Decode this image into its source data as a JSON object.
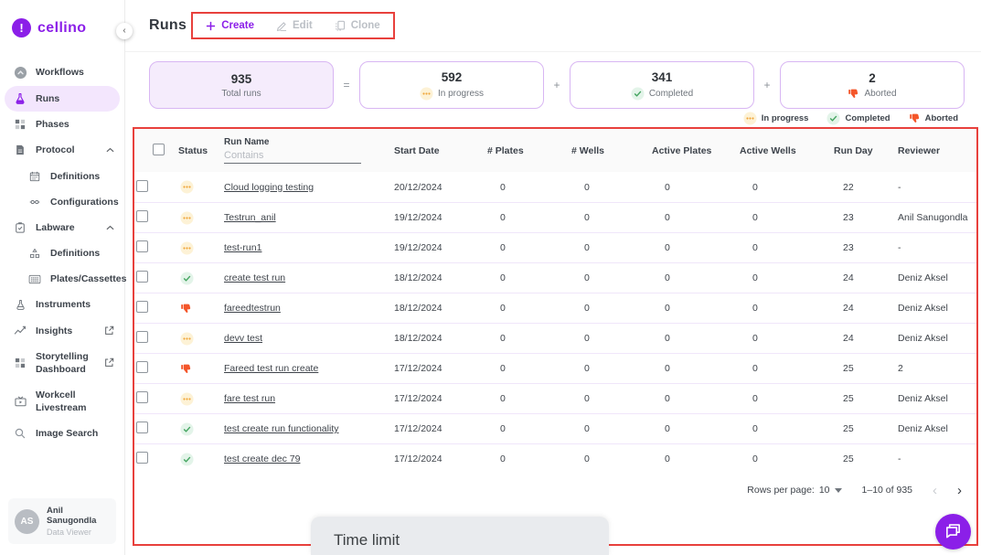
{
  "brand": {
    "name": "cellino"
  },
  "sidebar": {
    "items": [
      {
        "id": "workflows",
        "label": "Workflows",
        "icon": "workflows"
      },
      {
        "id": "runs",
        "label": "Runs",
        "icon": "runs",
        "selected": true
      },
      {
        "id": "phases",
        "label": "Phases",
        "icon": "phases"
      },
      {
        "id": "protocol",
        "label": "Protocol",
        "icon": "protocol",
        "expandable": true
      },
      {
        "id": "protocol-definitions",
        "label": "Definitions",
        "icon": "calendar",
        "child": true
      },
      {
        "id": "configurations",
        "label": "Configurations",
        "icon": "sliders",
        "child": true
      },
      {
        "id": "labware",
        "label": "Labware",
        "icon": "labware",
        "expandable": true
      },
      {
        "id": "labware-definitions",
        "label": "Definitions",
        "icon": "hierarchy",
        "child": true
      },
      {
        "id": "plates-cassettes",
        "label": "Plates/Cassettes",
        "icon": "plates",
        "child": true
      },
      {
        "id": "instruments",
        "label": "Instruments",
        "icon": "instruments"
      },
      {
        "id": "insights",
        "label": "Insights",
        "icon": "insights",
        "external": true
      },
      {
        "id": "storytelling-dashboard",
        "label": "Storytelling Dashboard",
        "icon": "dashboard",
        "external": true
      },
      {
        "id": "workcell-livestream",
        "label": "Workcell Livestream",
        "icon": "livestream"
      },
      {
        "id": "image-search",
        "label": "Image Search",
        "icon": "search"
      }
    ],
    "user": {
      "initials": "AS",
      "name": "Anil Sanugondla",
      "role": "Data Viewer"
    }
  },
  "header": {
    "title": "Runs",
    "buttons": [
      {
        "label": "Create",
        "icon": "plus",
        "enabled": true
      },
      {
        "label": "Edit",
        "icon": "pencil",
        "enabled": false
      },
      {
        "label": "Clone",
        "icon": "copy",
        "enabled": false
      }
    ]
  },
  "stats": {
    "cards": [
      {
        "value": "935",
        "label": "Total runs",
        "status": "total"
      },
      {
        "value": "592",
        "label": "In progress",
        "status": "in-progress"
      },
      {
        "value": "341",
        "label": "Completed",
        "status": "completed"
      },
      {
        "value": "2",
        "label": "Aborted",
        "status": "aborted"
      }
    ],
    "operators": [
      "=",
      "+",
      "+"
    ]
  },
  "legend": {
    "items": [
      {
        "label": "In progress",
        "status": "in-progress"
      },
      {
        "label": "Completed",
        "status": "completed"
      },
      {
        "label": "Aborted",
        "status": "aborted"
      }
    ]
  },
  "table": {
    "columns": [
      "Status",
      "Run Name",
      "Start Date",
      "# Plates",
      "# Wells",
      "Active Plates",
      "Active Wells",
      "Run Day",
      "Reviewer"
    ],
    "filter_placeholder": "Contains",
    "rows": [
      {
        "status": "in-progress",
        "run_name": "Cloud logging testing",
        "start_date": "20/12/2024",
        "num_plates": "0",
        "num_wells": "0",
        "active_plates": "0",
        "active_wells": "0",
        "run_day": "22",
        "reviewer": "-"
      },
      {
        "status": "in-progress",
        "run_name": "Testrun_anil",
        "start_date": "19/12/2024",
        "num_plates": "0",
        "num_wells": "0",
        "active_plates": "0",
        "active_wells": "0",
        "run_day": "23",
        "reviewer": "Anil Sanugondla"
      },
      {
        "status": "in-progress",
        "run_name": "test-run1",
        "start_date": "19/12/2024",
        "num_plates": "0",
        "num_wells": "0",
        "active_plates": "0",
        "active_wells": "0",
        "run_day": "23",
        "reviewer": "-"
      },
      {
        "status": "completed",
        "run_name": "create test run",
        "start_date": "18/12/2024",
        "num_plates": "0",
        "num_wells": "0",
        "active_plates": "0",
        "active_wells": "0",
        "run_day": "24",
        "reviewer": "Deniz Aksel"
      },
      {
        "status": "aborted",
        "run_name": "fareedtestrun",
        "start_date": "18/12/2024",
        "num_plates": "0",
        "num_wells": "0",
        "active_plates": "0",
        "active_wells": "0",
        "run_day": "24",
        "reviewer": "Deniz Aksel"
      },
      {
        "status": "in-progress",
        "run_name": "devv test",
        "start_date": "18/12/2024",
        "num_plates": "0",
        "num_wells": "0",
        "active_plates": "0",
        "active_wells": "0",
        "run_day": "24",
        "reviewer": "Deniz Aksel"
      },
      {
        "status": "aborted",
        "run_name": "Fareed test run create",
        "start_date": "17/12/2024",
        "num_plates": "0",
        "num_wells": "0",
        "active_plates": "0",
        "active_wells": "0",
        "run_day": "25",
        "reviewer": "2"
      },
      {
        "status": "in-progress",
        "run_name": "fare test run",
        "start_date": "17/12/2024",
        "num_plates": "0",
        "num_wells": "0",
        "active_plates": "0",
        "active_wells": "0",
        "run_day": "25",
        "reviewer": "Deniz Aksel"
      },
      {
        "status": "completed",
        "run_name": "test create run functionality",
        "start_date": "17/12/2024",
        "num_plates": "0",
        "num_wells": "0",
        "active_plates": "0",
        "active_wells": "0",
        "run_day": "25",
        "reviewer": "Deniz Aksel"
      },
      {
        "status": "completed",
        "run_name": "test create dec 79",
        "start_date": "17/12/2024",
        "num_plates": "0",
        "num_wells": "0",
        "active_plates": "0",
        "active_wells": "0",
        "run_day": "25",
        "reviewer": "-"
      }
    ],
    "pagination": {
      "rows_per_page_label": "Rows per page:",
      "rows_per_page": "10",
      "range": "1–10 of 935"
    }
  },
  "overlay": {
    "time_limit_label": "Time limit"
  },
  "colors": {
    "brand_purple": "#8b1fe8",
    "selected_pill": "#f3e6fd",
    "card_border": "#d8b6f3",
    "annotation_red": "#e8403c",
    "in_progress": "#efa63b",
    "completed": "#43a45f",
    "aborted": "#f4562a"
  }
}
